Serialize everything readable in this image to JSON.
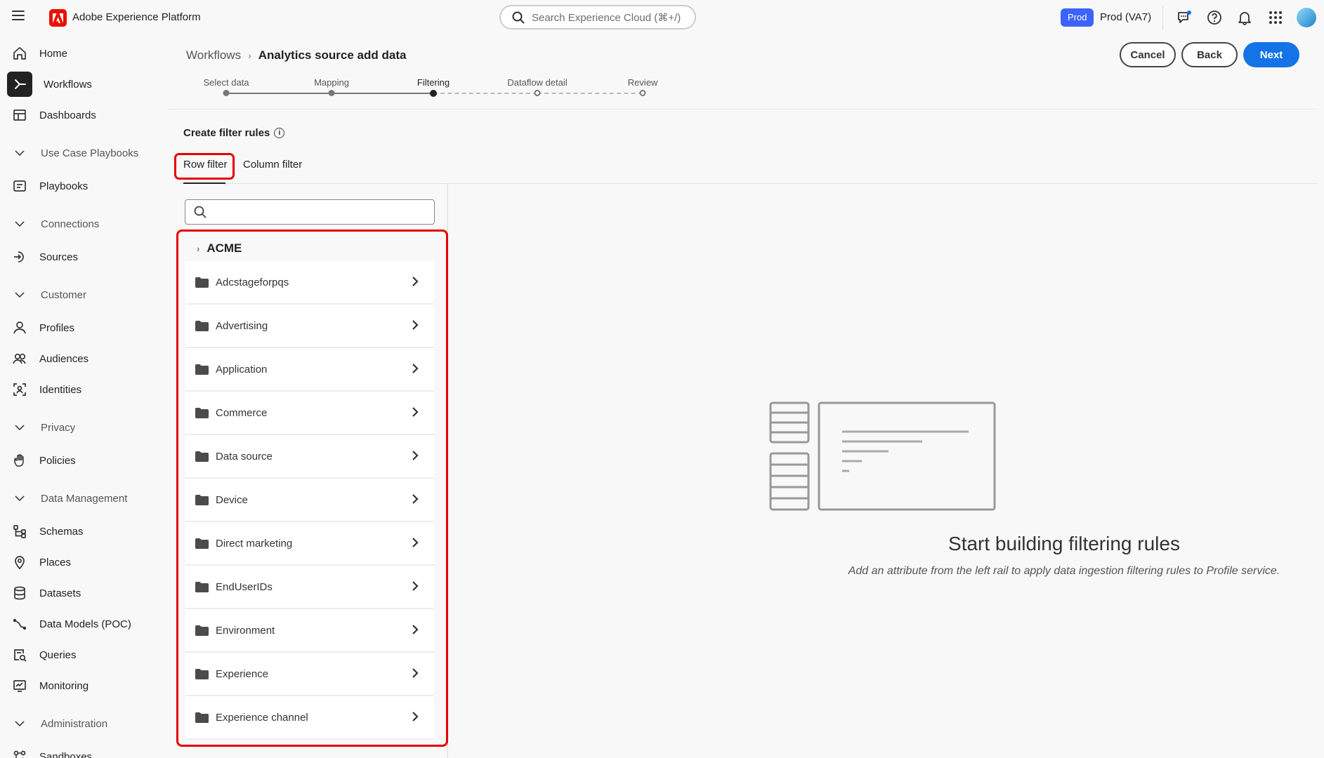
{
  "app": {
    "title": "Adobe Experience Platform",
    "search_placeholder": "Search Experience Cloud (⌘+/)",
    "env_badge": "Prod",
    "env_name": "Prod (VA7)"
  },
  "sidebar": {
    "items": [
      {
        "type": "item",
        "label": "Home",
        "icon": "home-icon"
      },
      {
        "type": "item",
        "label": "Workflows",
        "icon": "workflows-icon",
        "active": true
      },
      {
        "type": "item",
        "label": "Dashboards",
        "icon": "dashboards-icon"
      },
      {
        "type": "section",
        "label": "Use Case Playbooks"
      },
      {
        "type": "item",
        "label": "Playbooks",
        "icon": "playbooks-icon"
      },
      {
        "type": "section",
        "label": "Connections"
      },
      {
        "type": "item",
        "label": "Sources",
        "icon": "sources-icon"
      },
      {
        "type": "section",
        "label": "Customer"
      },
      {
        "type": "item",
        "label": "Profiles",
        "icon": "profiles-icon"
      },
      {
        "type": "item",
        "label": "Audiences",
        "icon": "audiences-icon"
      },
      {
        "type": "item",
        "label": "Identities",
        "icon": "identities-icon"
      },
      {
        "type": "section",
        "label": "Privacy"
      },
      {
        "type": "item",
        "label": "Policies",
        "icon": "policies-icon"
      },
      {
        "type": "section",
        "label": "Data Management"
      },
      {
        "type": "item",
        "label": "Schemas",
        "icon": "schemas-icon"
      },
      {
        "type": "item",
        "label": "Places",
        "icon": "places-icon"
      },
      {
        "type": "item",
        "label": "Datasets",
        "icon": "datasets-icon"
      },
      {
        "type": "item",
        "label": "Data Models (POC)",
        "icon": "data-models-icon"
      },
      {
        "type": "item",
        "label": "Queries",
        "icon": "queries-icon"
      },
      {
        "type": "item",
        "label": "Monitoring",
        "icon": "monitoring-icon"
      },
      {
        "type": "section",
        "label": "Administration"
      },
      {
        "type": "item",
        "label": "Sandboxes",
        "icon": "sandboxes-icon"
      }
    ]
  },
  "breadcrumb": {
    "parent": "Workflows",
    "current": "Analytics source add data"
  },
  "actions": {
    "cancel": "Cancel",
    "back": "Back",
    "next": "Next"
  },
  "steps": [
    {
      "label": "Select data",
      "state": "done"
    },
    {
      "label": "Mapping",
      "state": "done"
    },
    {
      "label": "Filtering",
      "state": "active"
    },
    {
      "label": "Dataflow detail",
      "state": "pending"
    },
    {
      "label": "Review",
      "state": "pending"
    }
  ],
  "filter": {
    "title": "Create filter rules",
    "tabs": [
      "Row filter",
      "Column filter"
    ],
    "active_tab": "Row filter",
    "search_value": "",
    "root": "ACME",
    "folders": [
      "Adcstageforpqs",
      "Advertising",
      "Application",
      "Commerce",
      "Data source",
      "Device",
      "Direct marketing",
      "EndUserIDs",
      "Environment",
      "Experience",
      "Experience channel"
    ]
  },
  "empty_state": {
    "title": "Start building filtering rules",
    "subtitle": "Add an attribute from the left rail to apply data ingestion filtering rules to Profile service."
  },
  "colors": {
    "accent": "#1473e6",
    "env_badge": "#3b63fb",
    "highlight": "#e60000",
    "adobe_red": "#eb1000"
  }
}
